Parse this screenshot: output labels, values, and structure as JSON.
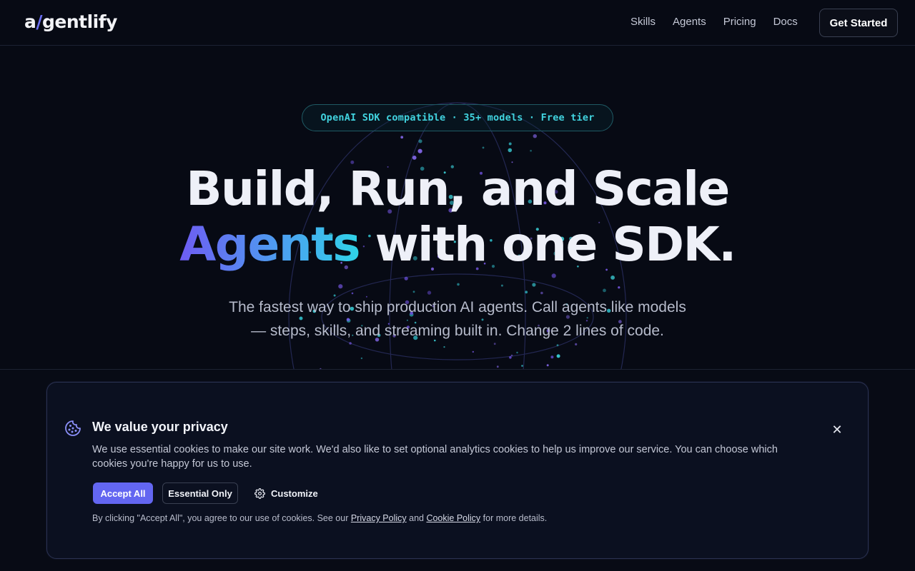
{
  "nav": {
    "logo_a": "a",
    "logo_slash": "/",
    "logo_rest": "gentlify",
    "links": [
      "Skills",
      "Agents",
      "Pricing",
      "Docs"
    ],
    "cta": "Get Started"
  },
  "hero": {
    "badge": "OpenAI SDK compatible · 35+ models · Free tier",
    "headline_line1": "Build, Run, and Scale",
    "headline_highlight": "Agents",
    "headline_line2_rest": " with one SDK.",
    "subtitle": "The fastest way to ship production AI agents. Call agents like models — steps, skills, and streaming built in. Change 2 lines of code."
  },
  "cookie": {
    "title": "We value your privacy",
    "body": "We use essential cookies to make our site work. We'd also like to set optional analytics cookies to help us improve our service. You can choose which cookies you're happy for us to use.",
    "accept_label": "Accept All",
    "essential_label": "Essential Only",
    "customize_label": "Customize",
    "close_glyph": "✕",
    "footer_prefix": "By clicking \"Accept All\", you agree to our use of cookies. See our ",
    "privacy_link": "Privacy Policy",
    "footer_and": " and ",
    "cookie_link": "Cookie Policy",
    "footer_suffix": " for more details."
  },
  "icons": {
    "cookie": "cookie-icon",
    "gear": "gear-icon",
    "close": "close-icon"
  },
  "colors": {
    "accent": "#6366f1",
    "teal": "#41d3df",
    "background": "#070a14"
  }
}
